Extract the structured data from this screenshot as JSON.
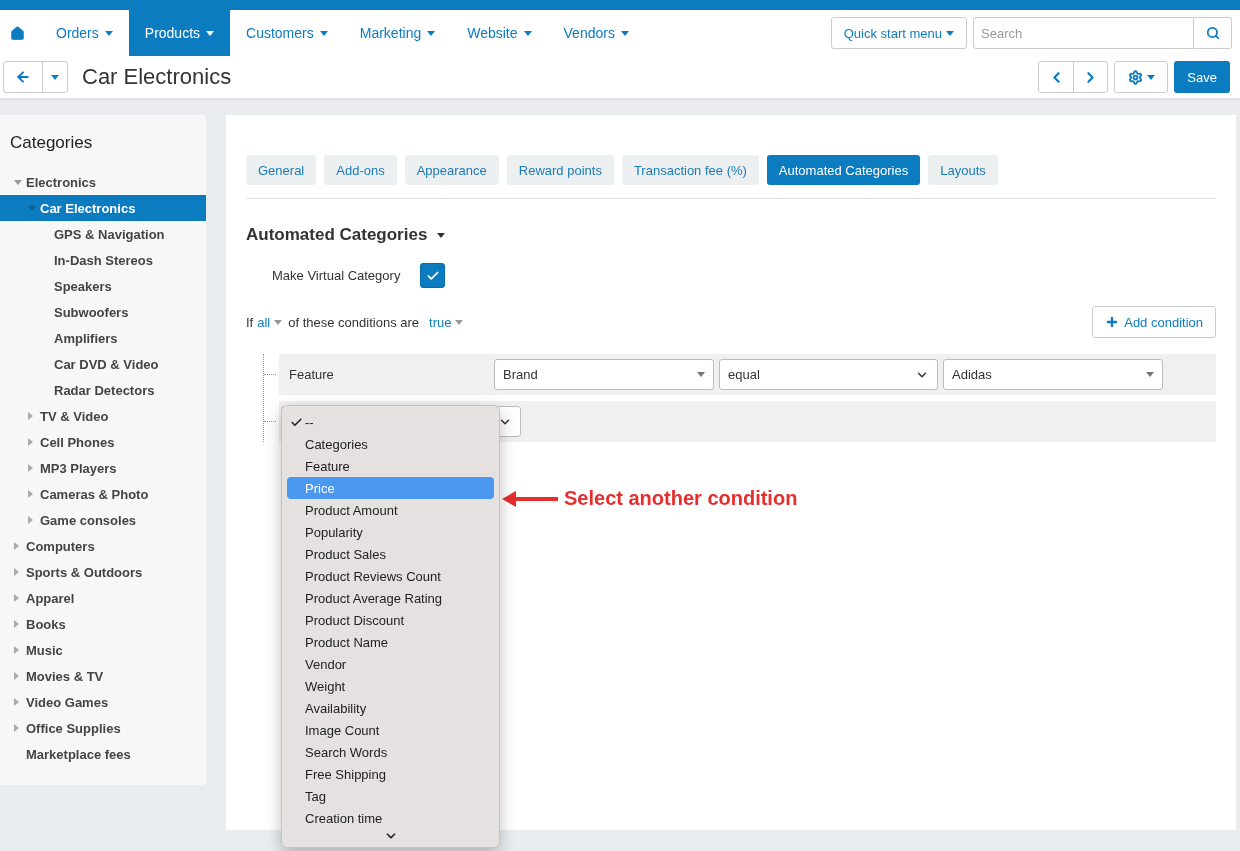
{
  "nav": {
    "items": [
      {
        "label": "Orders",
        "selected": false
      },
      {
        "label": "Products",
        "selected": true
      },
      {
        "label": "Customers",
        "selected": false
      },
      {
        "label": "Marketing",
        "selected": false
      },
      {
        "label": "Website",
        "selected": false
      },
      {
        "label": "Vendors",
        "selected": false
      }
    ],
    "quick_start": "Quick start menu",
    "search": {
      "placeholder": "Search"
    }
  },
  "header": {
    "title": "Car Electronics",
    "save": "Save"
  },
  "sidebar": {
    "title": "Categories",
    "items": [
      {
        "label": "Electronics",
        "expanded": true,
        "selected": false,
        "children": [
          {
            "label": "Car Electronics",
            "expanded": true,
            "selected": true,
            "children": [
              {
                "label": "GPS & Navigation",
                "selected": false
              },
              {
                "label": "In-Dash Stereos",
                "selected": false
              },
              {
                "label": "Speakers",
                "selected": false
              },
              {
                "label": "Subwoofers",
                "selected": false
              },
              {
                "label": "Amplifiers",
                "selected": false
              },
              {
                "label": "Car DVD & Video",
                "selected": false
              },
              {
                "label": "Radar Detectors",
                "selected": false
              }
            ]
          },
          {
            "label": "TV & Video",
            "expanded": false,
            "selected": false
          },
          {
            "label": "Cell Phones",
            "expanded": false,
            "selected": false
          },
          {
            "label": "MP3 Players",
            "expanded": false,
            "selected": false
          },
          {
            "label": "Cameras & Photo",
            "expanded": false,
            "selected": false
          },
          {
            "label": "Game consoles",
            "expanded": false,
            "selected": false
          }
        ]
      },
      {
        "label": "Computers",
        "expanded": false,
        "selected": false
      },
      {
        "label": "Sports & Outdoors",
        "expanded": false,
        "selected": false
      },
      {
        "label": "Apparel",
        "expanded": false,
        "selected": false
      },
      {
        "label": "Books",
        "expanded": false,
        "selected": false
      },
      {
        "label": "Music",
        "expanded": false,
        "selected": false
      },
      {
        "label": "Movies & TV",
        "expanded": false,
        "selected": false
      },
      {
        "label": "Video Games",
        "expanded": false,
        "selected": false
      },
      {
        "label": "Office Supplies",
        "expanded": false,
        "selected": false
      },
      {
        "label": "Marketplace fees",
        "selected": false
      }
    ]
  },
  "tabs": [
    {
      "label": "General",
      "selected": false
    },
    {
      "label": "Add-ons",
      "selected": false
    },
    {
      "label": "Appearance",
      "selected": false
    },
    {
      "label": "Reward points",
      "selected": false
    },
    {
      "label": "Transaction fee (%)",
      "selected": false
    },
    {
      "label": "Automated Categories",
      "selected": true
    },
    {
      "label": "Layouts",
      "selected": false
    }
  ],
  "section": {
    "title": "Automated Categories",
    "virtual": {
      "label": "Make Virtual Category",
      "checked": true
    },
    "rule": {
      "prefix": "If",
      "match": "all",
      "middle": "of these conditions are",
      "value": "true"
    },
    "add_button": "Add condition",
    "conditions": [
      {
        "label": "Feature",
        "selects": [
          {
            "value": "Brand",
            "kind": "combo"
          },
          {
            "value": "equal",
            "kind": "native"
          },
          {
            "value": "Adidas",
            "kind": "combo"
          }
        ]
      }
    ],
    "dropdown": {
      "options": [
        {
          "label": "--",
          "selected": true,
          "highlighted": false
        },
        {
          "label": "Categories",
          "selected": false,
          "highlighted": false
        },
        {
          "label": "Feature",
          "selected": false,
          "highlighted": false
        },
        {
          "label": "Price",
          "selected": false,
          "highlighted": true
        },
        {
          "label": "Product Amount",
          "selected": false,
          "highlighted": false
        },
        {
          "label": "Popularity",
          "selected": false,
          "highlighted": false
        },
        {
          "label": "Product Sales",
          "selected": false,
          "highlighted": false
        },
        {
          "label": "Product Reviews Count",
          "selected": false,
          "highlighted": false
        },
        {
          "label": "Product Average Rating",
          "selected": false,
          "highlighted": false
        },
        {
          "label": "Product Discount",
          "selected": false,
          "highlighted": false
        },
        {
          "label": "Product Name",
          "selected": false,
          "highlighted": false
        },
        {
          "label": "Vendor",
          "selected": false,
          "highlighted": false
        },
        {
          "label": "Weight",
          "selected": false,
          "highlighted": false
        },
        {
          "label": "Availability",
          "selected": false,
          "highlighted": false
        },
        {
          "label": "Image Count",
          "selected": false,
          "highlighted": false
        },
        {
          "label": "Search Words",
          "selected": false,
          "highlighted": false
        },
        {
          "label": "Free Shipping",
          "selected": false,
          "highlighted": false
        },
        {
          "label": "Tag",
          "selected": false,
          "highlighted": false
        },
        {
          "label": "Creation time",
          "selected": false,
          "highlighted": false
        }
      ]
    }
  },
  "annotation": "Select another condition"
}
